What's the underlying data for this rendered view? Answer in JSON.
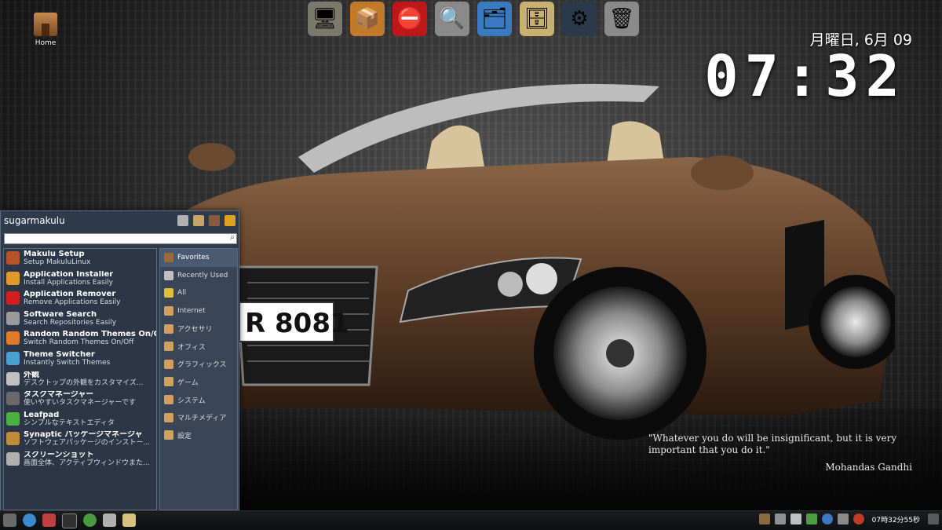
{
  "desktop": {
    "home_label": "Home"
  },
  "dock": {
    "items": [
      {
        "name": "file-manager-icon",
        "glyph": "🖥"
      },
      {
        "name": "package-icon",
        "glyph": "📦"
      },
      {
        "name": "remove-icon",
        "glyph": "⛔"
      },
      {
        "name": "search-icon",
        "glyph": "🔍"
      },
      {
        "name": "theme-switcher-icon",
        "glyph": "🗂"
      },
      {
        "name": "archive-icon",
        "glyph": "🗄"
      },
      {
        "name": "steam-icon",
        "glyph": "⚙"
      },
      {
        "name": "trash-icon",
        "glyph": "🗑"
      }
    ]
  },
  "clock": {
    "date": "月曜日, 6月 09",
    "time": "07:32"
  },
  "quote": {
    "text": "\"Whatever you do will be insignificant, but it is very important that you do it.\"",
    "author": "Mohandas Gandhi"
  },
  "menu": {
    "user": "sugarmakulu",
    "search_placeholder": "",
    "apps": [
      {
        "title": "Makulu Setup",
        "subtitle": "Setup MakuluLinux",
        "color": "#b5542c"
      },
      {
        "title": "Application Installer",
        "subtitle": "Install Applications Easily",
        "color": "#e09a2a"
      },
      {
        "title": "Application Remover",
        "subtitle": "Remove Applications Easily",
        "color": "#d21f1f"
      },
      {
        "title": "Software Search",
        "subtitle": "Search Repositories Easily",
        "color": "#9a9a9a"
      },
      {
        "title": "Random Random Themes On/Off",
        "subtitle": "Switch Random Themes On/Off",
        "color": "#e07a2a"
      },
      {
        "title": "Theme Switcher",
        "subtitle": "Instantly Switch Themes",
        "color": "#4aa0d0"
      },
      {
        "title": "外観",
        "subtitle": "デスクトップの外観をカスタマイズ...",
        "color": "#c0c0c0"
      },
      {
        "title": "タスクマネージャー",
        "subtitle": "使いやすいタスクマネージャーです",
        "color": "#6a6a6a"
      },
      {
        "title": "Leafpad",
        "subtitle": "シンプルなテキストエディタ",
        "color": "#4ab040"
      },
      {
        "title": "Synaptic パッケージマネージャ",
        "subtitle": "ソフトウェアパッケージのインストー...",
        "color": "#c08a3a"
      },
      {
        "title": "スクリーンショット",
        "subtitle": "画面全体、アクティブウィンドウまた...",
        "color": "#b0b0b0"
      }
    ],
    "categories": [
      {
        "label": "Favorites",
        "selected": true,
        "color": "#9a6a3a"
      },
      {
        "label": "Recently Used",
        "selected": false,
        "color": "#c0c0c0"
      },
      {
        "label": "All",
        "selected": false,
        "color": "#e0c030"
      },
      {
        "label": "Internet",
        "selected": false,
        "color": "#d0a060"
      },
      {
        "label": "アクセサリ",
        "selected": false,
        "color": "#d0a060"
      },
      {
        "label": "オフィス",
        "selected": false,
        "color": "#d0a060"
      },
      {
        "label": "グラフィックス",
        "selected": false,
        "color": "#d0a060"
      },
      {
        "label": "ゲーム",
        "selected": false,
        "color": "#d0a060"
      },
      {
        "label": "システム",
        "selected": false,
        "color": "#d0a060"
      },
      {
        "label": "マルチメディア",
        "selected": false,
        "color": "#d0a060"
      },
      {
        "label": "設定",
        "selected": false,
        "color": "#d0a060"
      }
    ]
  },
  "taskbar": {
    "clock": "07時32分55秒"
  }
}
